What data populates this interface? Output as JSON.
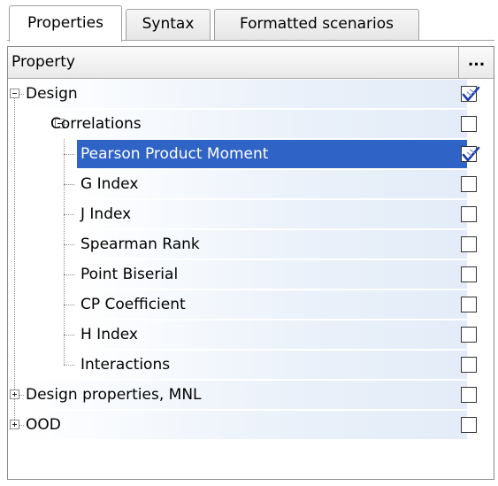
{
  "tabs": [
    {
      "label": "Properties",
      "active": true
    },
    {
      "label": "Syntax",
      "active": false
    },
    {
      "label": "Formatted scenarios",
      "active": false
    }
  ],
  "grid": {
    "header_property": "Property",
    "header_button": "..."
  },
  "rows": [
    {
      "label": "Design",
      "level": 0,
      "expandable": true,
      "expanded": true,
      "checked": true,
      "selected": false
    },
    {
      "label": "Correlations",
      "level": 1,
      "expandable": true,
      "expanded": true,
      "checked": false,
      "selected": false
    },
    {
      "label": "Pearson Product Moment",
      "level": 2,
      "expandable": false,
      "expanded": false,
      "checked": true,
      "selected": true
    },
    {
      "label": "G Index",
      "level": 2,
      "expandable": false,
      "expanded": false,
      "checked": false,
      "selected": false
    },
    {
      "label": "J Index",
      "level": 2,
      "expandable": false,
      "expanded": false,
      "checked": false,
      "selected": false
    },
    {
      "label": "Spearman Rank",
      "level": 2,
      "expandable": false,
      "expanded": false,
      "checked": false,
      "selected": false
    },
    {
      "label": "Point Biserial",
      "level": 2,
      "expandable": false,
      "expanded": false,
      "checked": false,
      "selected": false
    },
    {
      "label": "CP Coefficient",
      "level": 2,
      "expandable": false,
      "expanded": false,
      "checked": false,
      "selected": false
    },
    {
      "label": "H Index",
      "level": 2,
      "expandable": false,
      "expanded": false,
      "checked": false,
      "selected": false
    },
    {
      "label": "Interactions",
      "level": 2,
      "expandable": false,
      "expanded": false,
      "checked": false,
      "selected": false
    },
    {
      "label": "Design properties, MNL",
      "level": 0,
      "expandable": true,
      "expanded": false,
      "checked": false,
      "selected": false
    },
    {
      "label": "OOD",
      "level": 0,
      "expandable": true,
      "expanded": false,
      "checked": false,
      "selected": false
    }
  ],
  "colors": {
    "selection": "#2f63c5",
    "row_band": "#e3ecf8",
    "check_mark": "#1f3fa8"
  }
}
